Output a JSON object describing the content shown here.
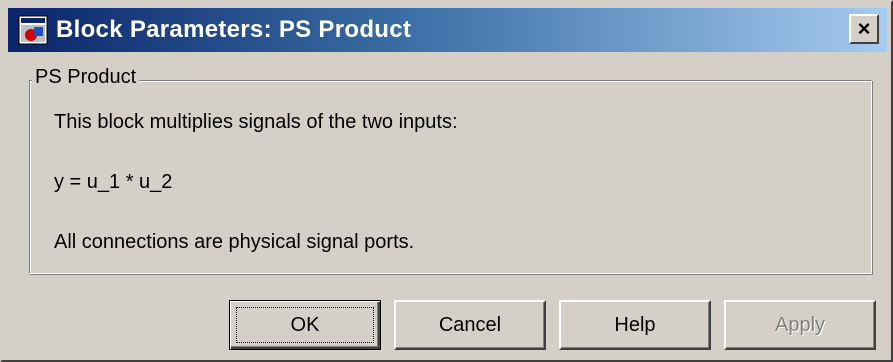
{
  "window": {
    "title": "Block Parameters: PS Product",
    "close_label": "×"
  },
  "group": {
    "legend": "PS Product",
    "description_line1": "This block multiplies signals of the two inputs:",
    "equation": "y = u_1 * u_2",
    "description_line2": "All connections are physical signal ports."
  },
  "buttons": {
    "ok": "OK",
    "cancel": "Cancel",
    "help": "Help",
    "apply": "Apply"
  },
  "colors": {
    "titlebar_start": "#0a246a",
    "titlebar_end": "#a6caf0",
    "dialog_face": "#d4d0c8",
    "disabled_text": "#808080"
  },
  "icons": {
    "app": "simulink-block-icon",
    "close": "close-icon"
  }
}
